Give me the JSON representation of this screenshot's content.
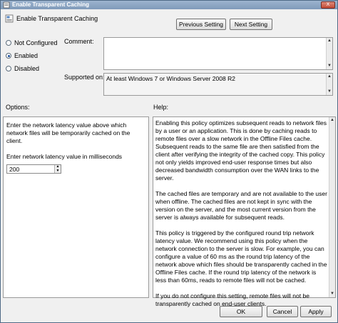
{
  "window": {
    "title": "Enable Transparent Caching",
    "close_glyph": "X"
  },
  "header": {
    "title": "Enable Transparent Caching"
  },
  "buttons": {
    "previous_setting": "Previous Setting",
    "next_setting": "Next Setting",
    "ok": "OK",
    "cancel": "Cancel",
    "apply": "Apply"
  },
  "state_options": [
    {
      "label": "Not Configured",
      "selected": false
    },
    {
      "label": "Enabled",
      "selected": true
    },
    {
      "label": "Disabled",
      "selected": false
    }
  ],
  "comment": {
    "label": "Comment:",
    "value": ""
  },
  "supported_on": {
    "label": "Supported on:",
    "value": "At least Windows 7 or Windows Server 2008 R2"
  },
  "options": {
    "label": "Options:",
    "description": "Enter the network latency value above which network files will be temporarily cached on the client.",
    "latency_label": "Enter network latency value in milliseconds",
    "latency_value": "200"
  },
  "help": {
    "label": "Help:",
    "paragraphs": [
      "Enabling this policy optimizes subsequent reads to network files by a user or an application. This is done by caching reads to remote files over a slow network in the Offline Files cache. Subsequent reads to the same file are then satisfied from the client after verifying the integrity of the cached copy. This policy not only yields improved end-user response times but also decreased bandwidth consumption over the WAN links to the server.",
      "The cached files are temporary and are not available to the user when offline. The cached files are not kept in sync with the version on the server, and the most current version from the server is always available for subsequent reads.",
      "This policy is triggered by the configured round trip network latency value. We recommend using this policy when the network connection to the server is slow. For example, you can configure a value of 60 ms as the round trip latency of the network above which files should be transparently cached in the Offline Files cache. If the round trip latency of the network is less than 60ms, reads to remote files will not be cached.",
      "If you do not configure this setting, remote files will not be transparently cached on end-user clients."
    ]
  },
  "colors": {
    "titlebar": "#8aa5c4",
    "accent": "#1a4e9b"
  }
}
